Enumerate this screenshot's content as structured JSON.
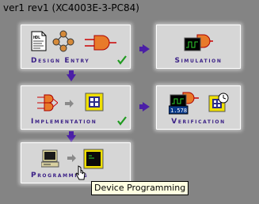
{
  "header": {
    "project": "ver1",
    "revision": "rev1",
    "device": "(XC4003E-3-PC84)"
  },
  "panels": {
    "design_entry": {
      "label": "Design Entry",
      "hdl_text": "HDL"
    },
    "simulation": {
      "label": "Simulation"
    },
    "implementation": {
      "label": "Implementation"
    },
    "verification": {
      "label": "Verification",
      "timing_text": "1.578"
    },
    "programming": {
      "label": "Programming"
    }
  },
  "tooltip": {
    "text": "Device Programming"
  }
}
